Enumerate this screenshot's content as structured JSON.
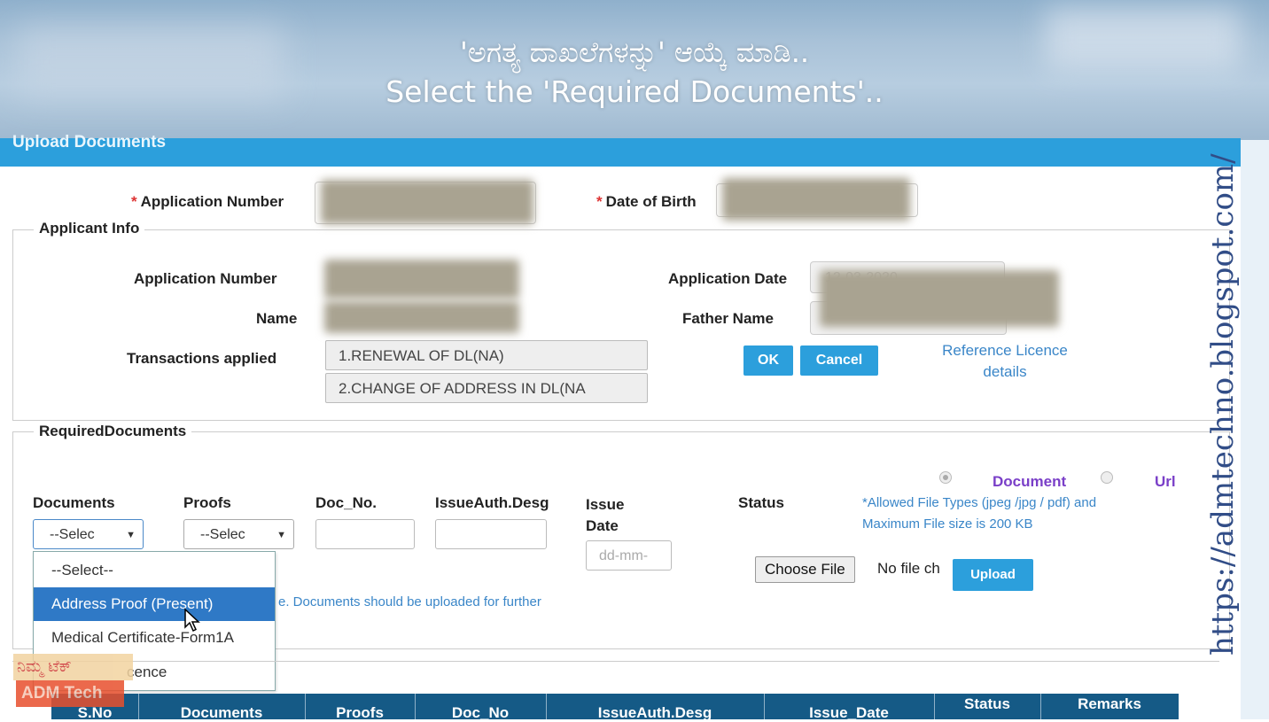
{
  "caption": {
    "kannada": "'ಅಗತ್ಯ ದಾಖಲೆಗಳನ್ನು' ಆಯ್ಕೆ ಮಾಡಿ..",
    "english": "Select the 'Required Documents'.."
  },
  "panel_title": "Upload Documents",
  "search": {
    "application_number_label": "Application Number",
    "dob_label": "Date of Birth",
    "required_mark": "*"
  },
  "applicant_info": {
    "legend": "Applicant Info",
    "application_number_label": "Application Number",
    "name_label": "Name",
    "transactions_label": "Transactions applied",
    "transactions": [
      "1.RENEWAL OF DL(NA)",
      "2.CHANGE OF ADDRESS IN DL(NA"
    ],
    "application_date_label": "Application Date",
    "application_date_value": "12-03-2020",
    "father_name_label": "Father Name",
    "ok_label": "OK",
    "cancel_label": "Cancel",
    "reference_link": "Reference Licence details"
  },
  "required_documents": {
    "legend": "RequiredDocuments",
    "columns": {
      "documents": "Documents",
      "proofs": "Proofs",
      "doc_no": "Doc_No.",
      "issue_auth": "IssueAuth.Desg",
      "issue_date": "Issue Date",
      "status": "Status"
    },
    "documents_select_value": "--Selec",
    "proofs_select_value": "--Selec",
    "issue_date_placeholder": "dd-mm-",
    "radio_document_label": "Document",
    "radio_url_label": "Url",
    "allowed_note": "*Allowed File Types (jpeg /jpg / pdf) and Maximum File size is 200 KB",
    "choose_file_label": "Choose File",
    "no_file_text": "No file ch",
    "upload_label": "Upload",
    "partial_note": "e. Documents should be uploaded for further",
    "dropdown_options": [
      "--Select--",
      "Address Proof (Present)",
      "Medical Certificate-Form1A",
      "cence"
    ],
    "highlighted_option": "Address Proof (Present)"
  },
  "table": {
    "headers": [
      "S.No",
      "Documents",
      "Proofs",
      "Doc_No",
      "IssueAuth.Desg",
      "Issue_Date",
      "Status",
      "Remarks"
    ]
  },
  "watermarks": {
    "url": "https://admtechno.blogspot.com/",
    "logo_kannada": "ನಿಮ್ಮ ಟೆಕ್",
    "logo_text": "ADM Tech"
  },
  "colors": {
    "accent": "#2c9fdc",
    "highlight": "#2f79c6",
    "table_header": "#155a86",
    "radio_label": "#7a3fc8",
    "note": "#3a86c8"
  }
}
